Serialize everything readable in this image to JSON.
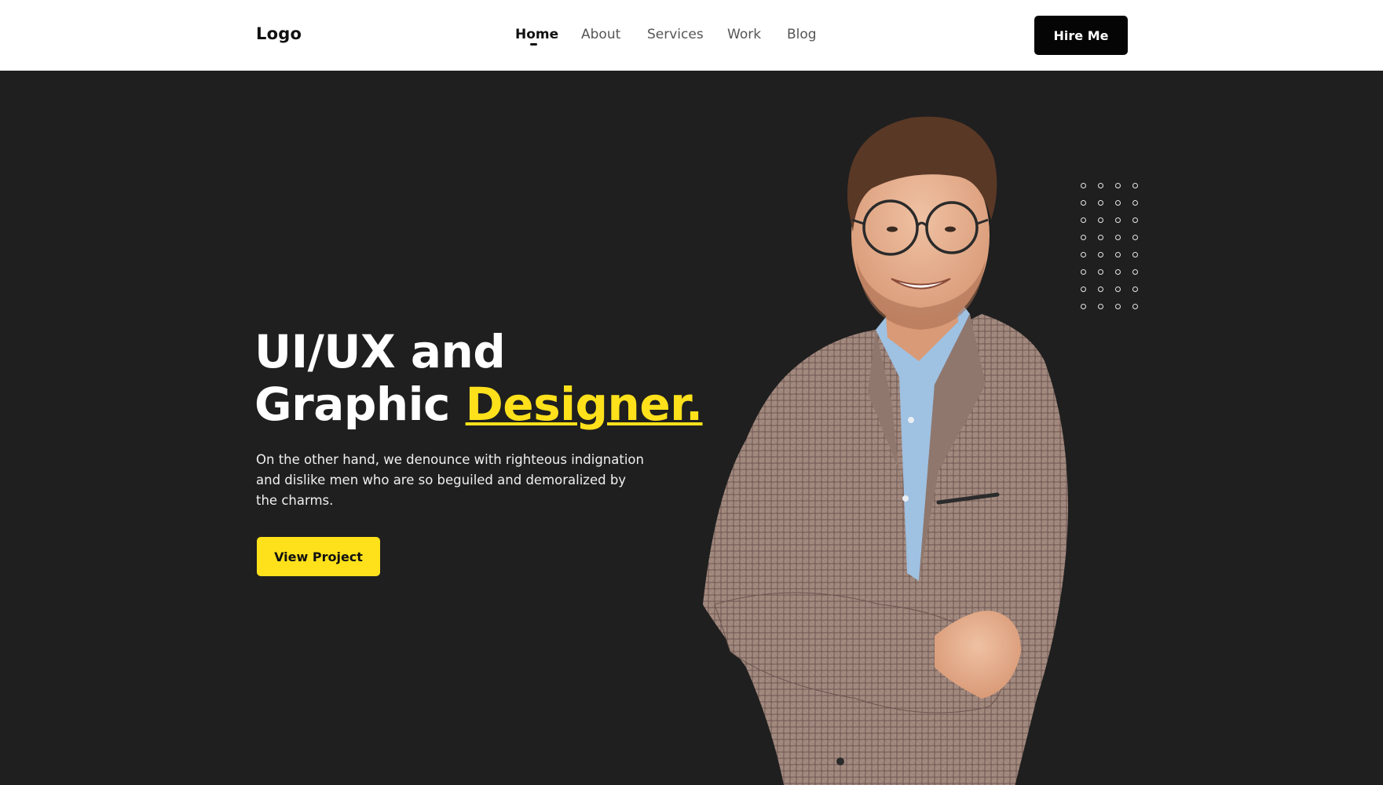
{
  "header": {
    "logo": "Logo",
    "nav": [
      {
        "label": "Home",
        "active": true
      },
      {
        "label": "About",
        "active": false
      },
      {
        "label": "Services",
        "active": false
      },
      {
        "label": "Work",
        "active": false
      },
      {
        "label": "Blog",
        "active": false
      }
    ],
    "hire_button": "Hire Me"
  },
  "hero": {
    "headline_line1": "UI/UX and",
    "headline_line2_prefix": "Graphic ",
    "headline_accent": "Designer.",
    "description": "On the other hand, we denounce with righteous indignation and dislike men who are so beguiled and demoralized by the charms.",
    "cta": "View Project",
    "image": "portrait-photo"
  },
  "colors": {
    "background": "#1f1f1f",
    "header_bg": "#ffffff",
    "accent": "#ffe11b",
    "button_dark": "#050505"
  }
}
